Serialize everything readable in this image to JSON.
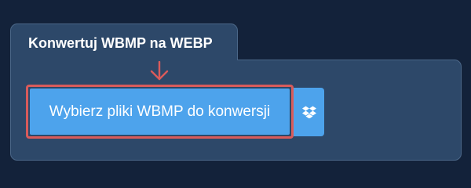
{
  "converter": {
    "tab_title": "Konwertuj WBMP na WEBP",
    "choose_files_label": "Wybierz pliki WBMP do konwersji",
    "dropbox_icon": "dropbox-icon",
    "arrow_icon": "arrow-down-icon"
  },
  "colors": {
    "page_background": "#13223a",
    "panel": "#2d4869",
    "button": "#4da3ec",
    "highlight": "#d95b5b"
  }
}
